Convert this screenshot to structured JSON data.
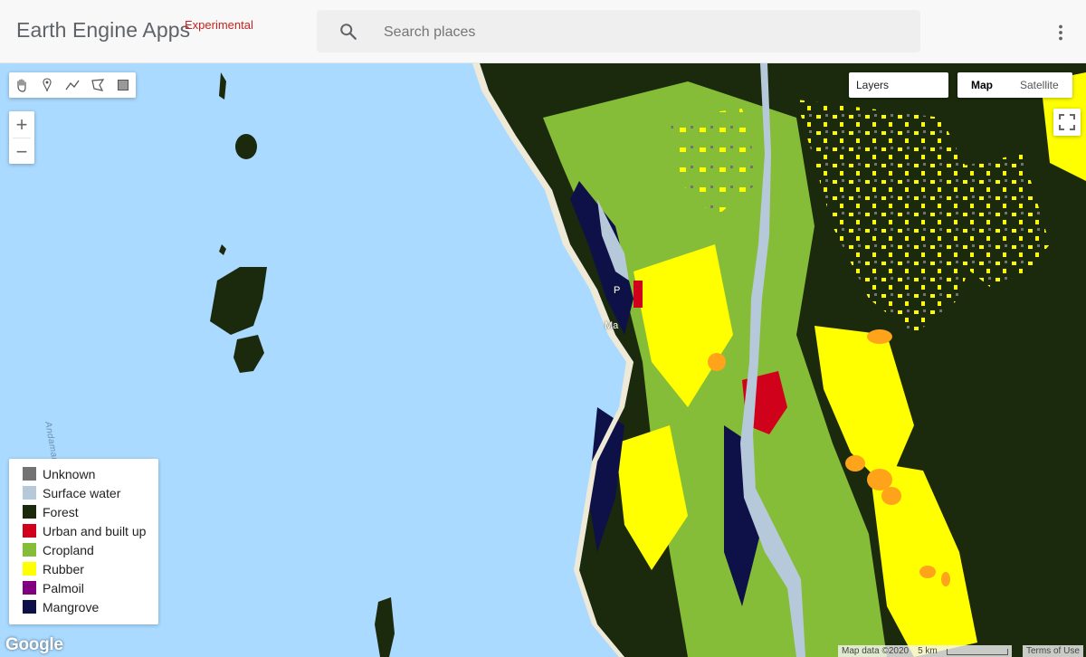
{
  "header": {
    "brand": "Earth Engine Apps",
    "brand_tag": "Experimental",
    "search_placeholder": "Search places"
  },
  "map": {
    "sea_label": "Andaman Sea",
    "place_label_1": "P",
    "place_label_2": "Ma",
    "zoom_in": "+",
    "zoom_out": "−",
    "layers_label": "Layers",
    "map_types": [
      "Map",
      "Satellite"
    ],
    "active_map_type": "Map",
    "google_logo": "Google",
    "attribution": "Map data ©2020",
    "scale_text": "5 km",
    "terms": "Terms of Use"
  },
  "legend": {
    "items": [
      {
        "label": "Unknown",
        "color": "#737373"
      },
      {
        "label": "Surface water",
        "color": "#b5c9da"
      },
      {
        "label": "Forest",
        "color": "#1b2a0c"
      },
      {
        "label": "Urban and built up",
        "color": "#d0021b"
      },
      {
        "label": "Cropland",
        "color": "#86bd38"
      },
      {
        "label": "Rubber",
        "color": "#ffff00"
      },
      {
        "label": "Palmoil",
        "color": "#800080"
      },
      {
        "label": "Mangrove",
        "color": "#0d1147"
      }
    ]
  },
  "colors": {
    "sea": "#aadaff",
    "accent": "#c5221f"
  }
}
